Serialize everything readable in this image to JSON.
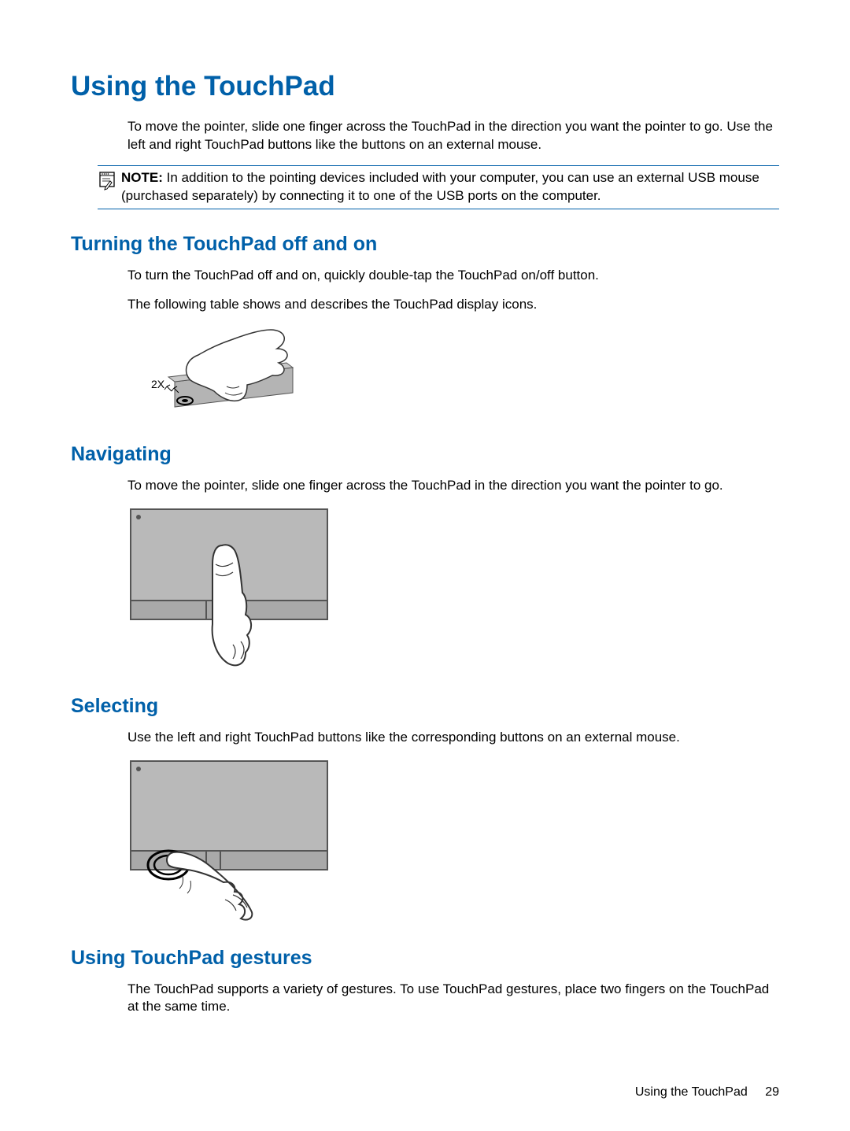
{
  "title": "Using the TouchPad",
  "intro": "To move the pointer, slide one finger across the TouchPad in the direction you want the pointer to go. Use the left and right TouchPad buttons like the buttons on an external mouse.",
  "note": {
    "label": "NOTE:",
    "text": "In addition to the pointing devices included with your computer, you can use an external USB mouse (purchased separately) by connecting it to one of the USB ports on the computer."
  },
  "sections": {
    "turning": {
      "heading": "Turning the TouchPad off and on",
      "p1": "To turn the TouchPad off and on, quickly double-tap the TouchPad on/off button.",
      "p2": "The following table shows and describes the TouchPad display icons.",
      "img_label": "2X"
    },
    "navigating": {
      "heading": "Navigating",
      "p1": "To move the pointer, slide one finger across the TouchPad in the direction you want the pointer to go."
    },
    "selecting": {
      "heading": "Selecting",
      "p1": "Use the left and right TouchPad buttons like the corresponding buttons on an external mouse."
    },
    "gestures": {
      "heading": "Using TouchPad gestures",
      "p1": "The TouchPad supports a variety of gestures. To use TouchPad gestures, place two fingers on the TouchPad at the same time."
    }
  },
  "footer": {
    "section": "Using the TouchPad",
    "page": "29"
  }
}
